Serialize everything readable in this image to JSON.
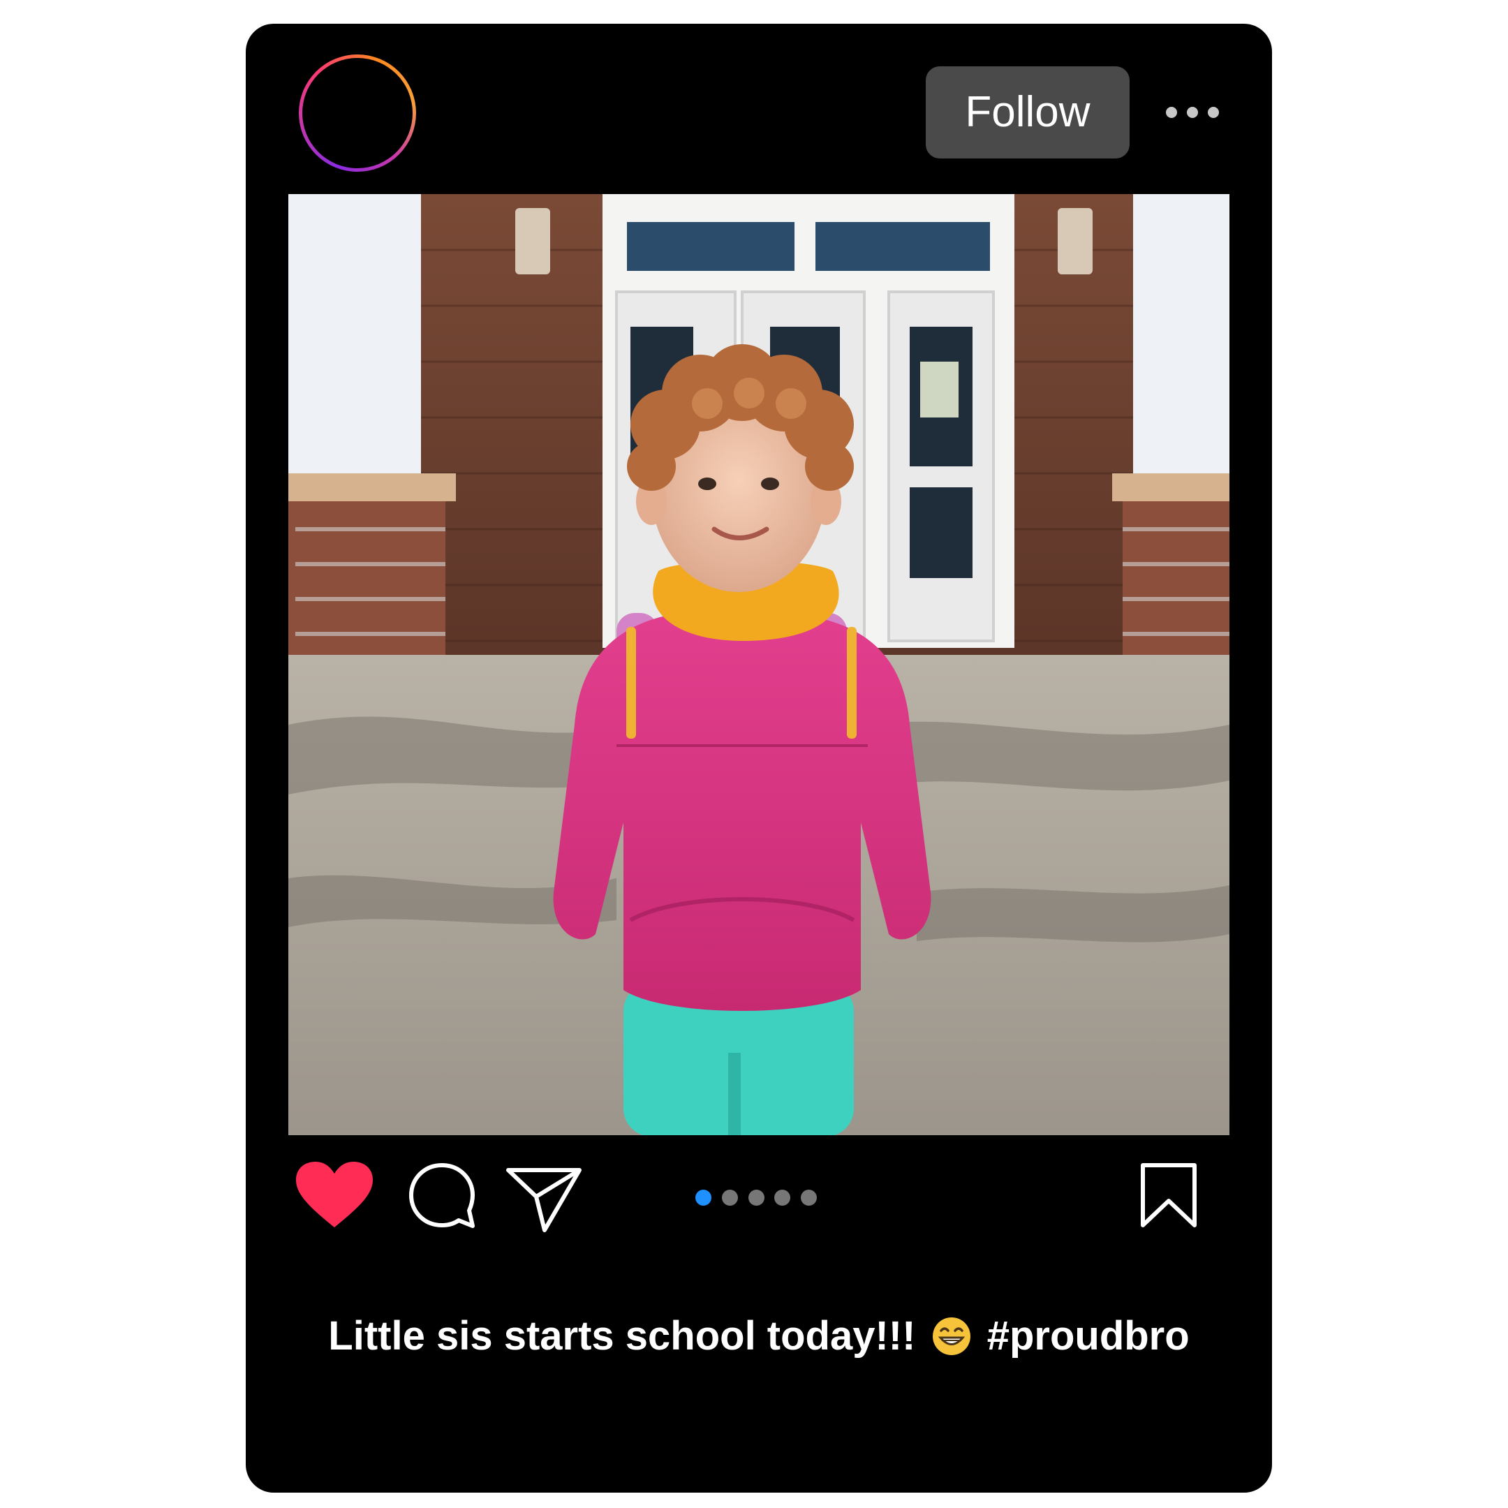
{
  "post": {
    "follow_label": "Follow",
    "more_icon": "more-horizontal-icon",
    "photo_alt": "Child in pink hoodie with yellow scarf and backpack standing in front of a school entrance",
    "caption_text": "Little sis starts school today!!!",
    "caption_emoji": "😁",
    "caption_hashtag": "#proudbro",
    "actions": {
      "like_icon": "heart-icon",
      "like_state": "liked",
      "comment_icon": "comment-icon",
      "share_icon": "send-icon",
      "save_icon": "bookmark-icon"
    },
    "carousel": {
      "count": 5,
      "active_index": 0
    }
  },
  "colors": {
    "card_background": "#000000",
    "follow_button_bg": "#4a4a4a",
    "like_red": "#ff2d55",
    "carousel_active": "#1e90ff",
    "carousel_inactive": "#777777",
    "avatar_ring_gradient": [
      "#8a2be2",
      "#c837ab",
      "#ff3c6f",
      "#ff8a1f"
    ]
  }
}
